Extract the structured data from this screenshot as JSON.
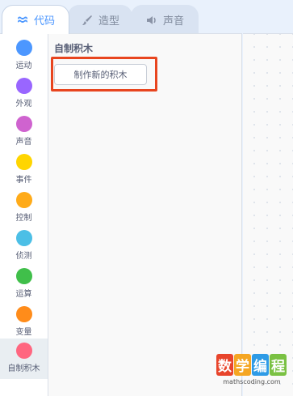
{
  "tabs": [
    {
      "label": "代码",
      "icon": "code-icon",
      "active": true
    },
    {
      "label": "造型",
      "icon": "brush-icon",
      "active": false
    },
    {
      "label": "声音",
      "icon": "speaker-icon",
      "active": false
    }
  ],
  "categories": [
    {
      "label": "运动",
      "color": "#4c97ff"
    },
    {
      "label": "外观",
      "color": "#9966ff"
    },
    {
      "label": "声音",
      "color": "#cf63cf"
    },
    {
      "label": "事件",
      "color": "#ffd500"
    },
    {
      "label": "控制",
      "color": "#ffab19"
    },
    {
      "label": "侦测",
      "color": "#4cbfe6"
    },
    {
      "label": "运算",
      "color": "#40bf4a"
    },
    {
      "label": "变量",
      "color": "#ff8c1a"
    },
    {
      "label": "自制积木",
      "color": "#ff6680"
    }
  ],
  "flyout": {
    "title": "自制积木",
    "make_block_label": "制作新的积木",
    "highlight_color": "#e8451f"
  },
  "watermark": {
    "chars": [
      {
        "text": "数",
        "color": "#e8452c"
      },
      {
        "text": "学",
        "color": "#f5a623"
      },
      {
        "text": "编",
        "color": "#2e9be6"
      },
      {
        "text": "程",
        "color": "#7ac143"
      }
    ],
    "url": "mathscoding.com"
  }
}
